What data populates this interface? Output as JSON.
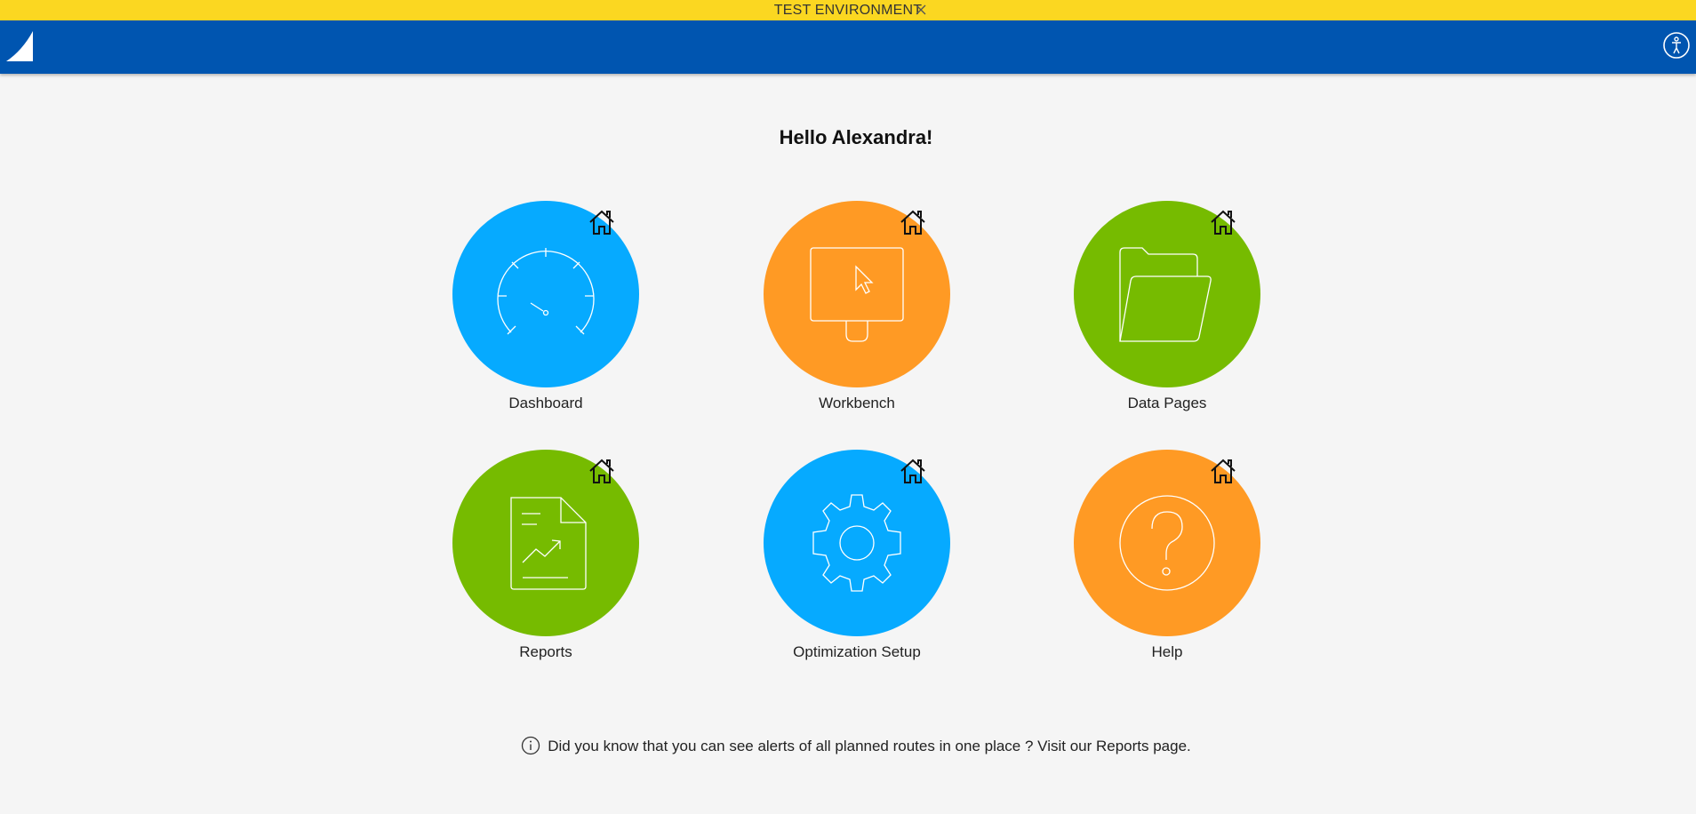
{
  "banner": {
    "text": "TEST ENVIRONMENT",
    "close_icon": "close-icon"
  },
  "header": {
    "logo_icon": "sail-logo-icon",
    "accessibility_icon": "accessibility-icon",
    "bar_color": "#0055b0"
  },
  "greeting": "Hello Alexandra!",
  "tiles": [
    {
      "label": "Dashboard",
      "color": "#06aaff",
      "icon": "speedometer-icon"
    },
    {
      "label": "Workbench",
      "color": "#ff9a24",
      "icon": "monitor-cursor-icon"
    },
    {
      "label": "Data Pages",
      "color": "#76bb00",
      "icon": "folder-icon"
    },
    {
      "label": "Reports",
      "color": "#76bb00",
      "icon": "report-chart-icon"
    },
    {
      "label": "Optimization Setup",
      "color": "#06aaff",
      "icon": "gear-icon"
    },
    {
      "label": "Help",
      "color": "#ff9a24",
      "icon": "question-icon"
    }
  ],
  "tip": "Did you know that you can see alerts of all planned routes in one place ? Visit our Reports page."
}
